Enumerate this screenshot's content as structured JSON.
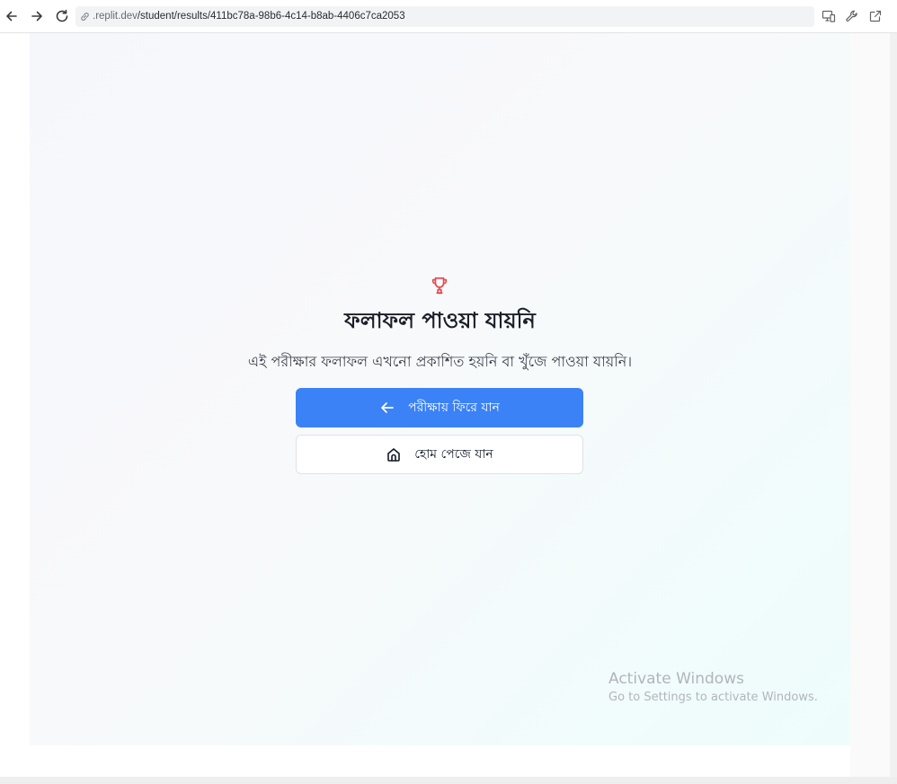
{
  "browser": {
    "url_host": ".replit.dev",
    "url_path": "/student/results/411bc78a-98b6-4c14-b8ab-4406c7ca2053",
    "icons": [
      "back-icon",
      "forward-icon",
      "reload-icon",
      "link-icon",
      "devices-icon",
      "wrench-icon",
      "open-external-icon"
    ]
  },
  "result": {
    "icon": "trophy-icon",
    "icon_color": "#e5484d",
    "title": "ফলাফল পাওয়া যায়নি",
    "message": "এই পরীক্ষার ফলাফল এখনো প্রকাশিত হয়নি বা খুঁজে পাওয়া যায়নি।",
    "back_button_label": "পরীক্ষায় ফিরে যান",
    "home_button_label": "হোম পেজে যান",
    "primary_color": "#3b82f6"
  },
  "watermark": {
    "line1": "Activate Windows",
    "line2": "Go to Settings to activate Windows."
  }
}
